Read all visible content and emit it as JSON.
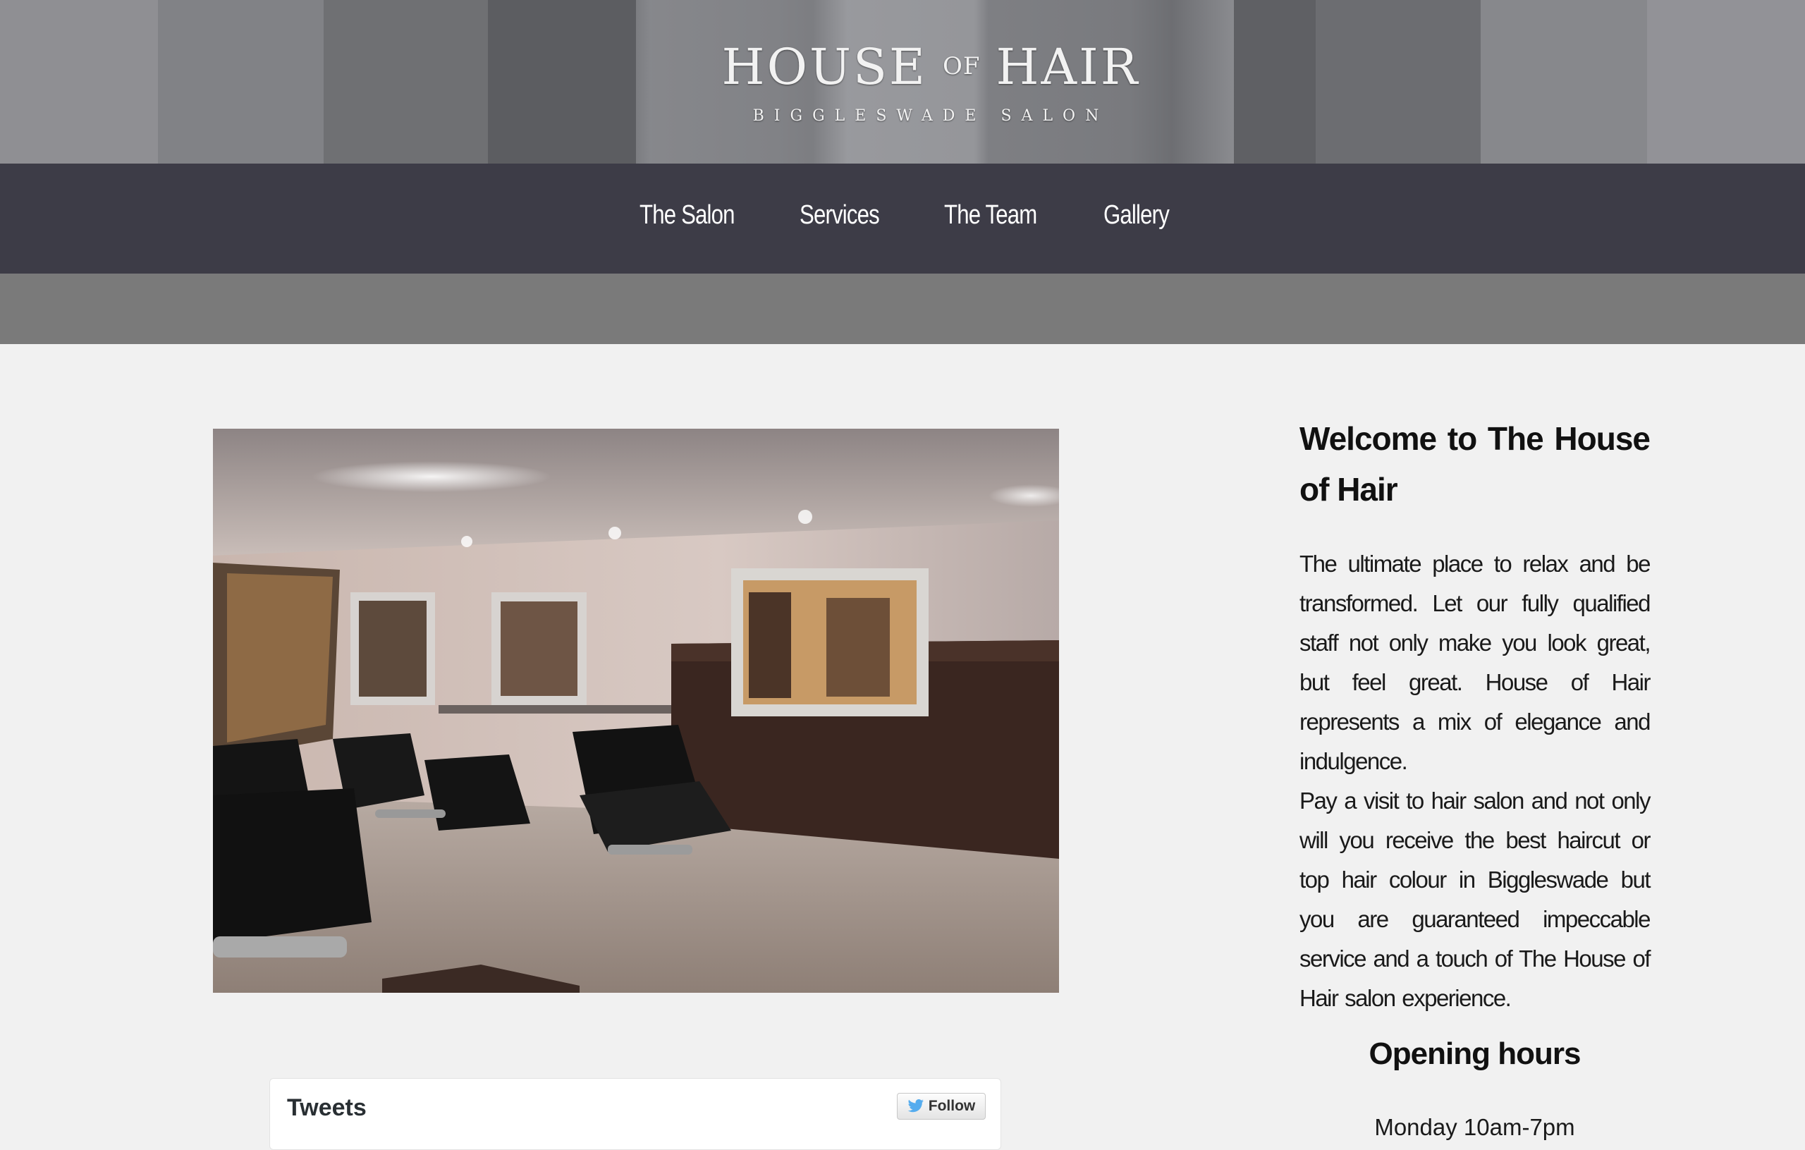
{
  "header": {
    "logo_main_1": "HOUSE",
    "logo_of": "OF",
    "logo_main_2": "HAIR",
    "logo_subtitle": "BIGGLESWADE SALON"
  },
  "nav": {
    "items": [
      {
        "label": "The Salon"
      },
      {
        "label": "Services"
      },
      {
        "label": "The Team"
      },
      {
        "label": "Gallery"
      }
    ]
  },
  "welcome": {
    "title": "Welcome to The House of Hair",
    "paragraph_1": "The ultimate place to relax and be transformed. Let our fully qualified staff not only make you look great, but feel great. House of Hair represents a mix of elegance and indulgence.",
    "paragraph_2": "Pay a visit to hair salon and not only will you receive the best haircut or top hair colour in Biggleswade but you are guaranteed impeccable service and a touch of The House of Hair salon experience."
  },
  "hours": {
    "title": "Opening hours",
    "first_line": "Monday 10am-7pm"
  },
  "twitter": {
    "title": "Tweets",
    "follow_label": "Follow"
  },
  "colors": {
    "nav_bg": "#3d3c47",
    "page_bg": "#f1f1f1",
    "grey_band": "#7a7a7a",
    "twitter_blue": "#55acee"
  }
}
